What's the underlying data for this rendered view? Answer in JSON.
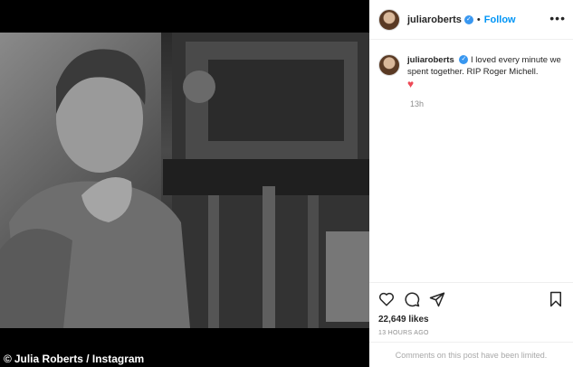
{
  "post": {
    "credit_symbol": "©",
    "credit_text": "Julia Roberts / Instagram"
  },
  "header": {
    "username": "juliaroberts",
    "verified_mark": "✓",
    "separator": "•",
    "follow_label": "Follow",
    "more_icon": "•••"
  },
  "caption": {
    "username": "juliaroberts",
    "text": "I loved every minute we spent together. RIP Roger Michell.",
    "emoji": "♥",
    "time": "13h"
  },
  "actions": {
    "likes": "22,649 likes",
    "posted_ago": "13 HOURS AGO"
  },
  "comments": {
    "limited_text": "Comments on this post have been limited."
  },
  "icons": [
    "heart-icon",
    "comment-icon",
    "share-icon",
    "bookmark-icon",
    "verified-icon",
    "more-icon"
  ]
}
